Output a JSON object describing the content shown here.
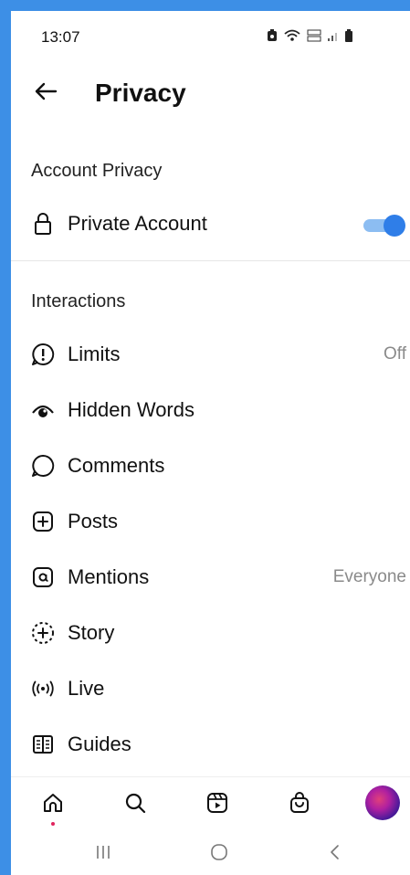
{
  "status_bar": {
    "time": "13:07"
  },
  "header": {
    "title": "Privacy",
    "back_icon": "arrow-left-icon"
  },
  "account_privacy": {
    "section_title": "Account Privacy",
    "private_account": {
      "label": "Private Account",
      "icon": "lock-icon",
      "enabled": true
    }
  },
  "interactions": {
    "section_title": "Interactions",
    "items": [
      {
        "label": "Limits",
        "icon": "limits-icon",
        "value": "Off"
      },
      {
        "label": "Hidden Words",
        "icon": "hidden-words-icon",
        "value": ""
      },
      {
        "label": "Comments",
        "icon": "comment-icon",
        "value": ""
      },
      {
        "label": "Posts",
        "icon": "plus-square-icon",
        "value": ""
      },
      {
        "label": "Mentions",
        "icon": "at-icon",
        "value": "Everyone"
      },
      {
        "label": "Story",
        "icon": "story-add-icon",
        "value": ""
      },
      {
        "label": "Live",
        "icon": "live-icon",
        "value": ""
      },
      {
        "label": "Guides",
        "icon": "guides-icon",
        "value": ""
      }
    ]
  },
  "bottom_nav": {
    "items": [
      "home-icon",
      "search-icon",
      "reels-icon",
      "shop-icon",
      "profile-avatar"
    ]
  },
  "colors": {
    "accent": "#2f7ee8",
    "background_frame": "#3d8fe6"
  }
}
